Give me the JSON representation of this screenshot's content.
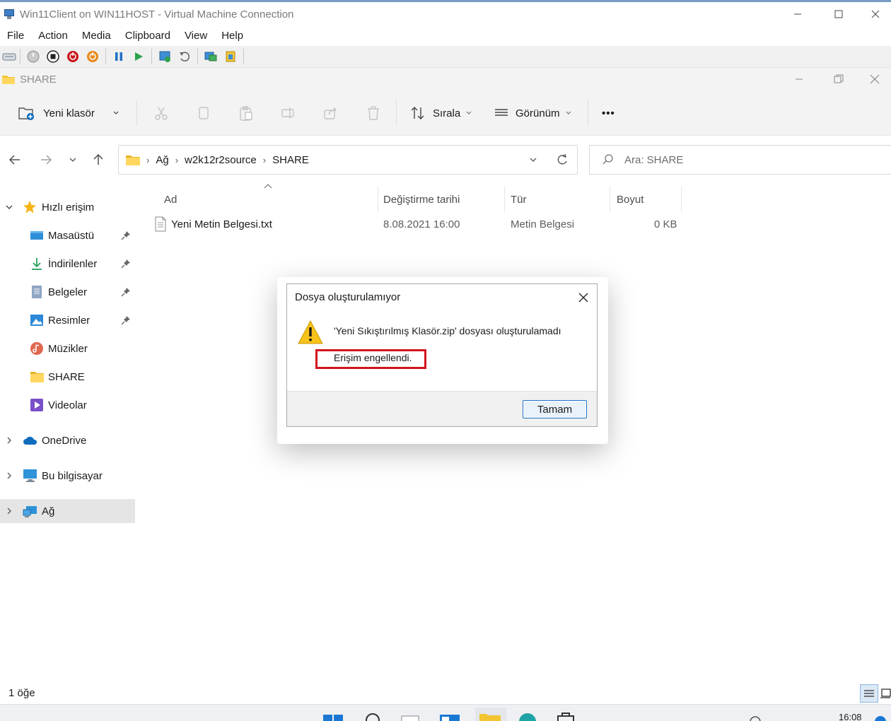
{
  "vm_window": {
    "title": "Win11Client on WIN11HOST - Virtual Machine Connection",
    "menu": [
      "File",
      "Action",
      "Media",
      "Clipboard",
      "View",
      "Help"
    ],
    "toolbar_icons": [
      "ctrl-alt-del-icon",
      "start-icon",
      "turn-off-icon",
      "shutdown-icon",
      "save-icon",
      "pause-icon",
      "resume-icon",
      "checkpoint-icon",
      "revert-icon",
      "enhanced-session-icon",
      "share-icon"
    ]
  },
  "explorer": {
    "title": "SHARE",
    "commands": {
      "new_folder": "Yeni klasör",
      "sort": "Sırala",
      "view": "Görünüm",
      "more": "•••"
    },
    "address": {
      "crumbs": [
        "Ağ",
        "w2k12r2source",
        "SHARE"
      ]
    },
    "search_placeholder": "Ara: SHARE",
    "sidebar": {
      "quick_access": "Hızlı erişim",
      "items": [
        "Masaüstü",
        "İndirilenler",
        "Belgeler",
        "Resimler",
        "Müzikler",
        "SHARE",
        "Videolar"
      ],
      "onedrive": "OneDrive",
      "this_pc": "Bu bilgisayar",
      "network": "Ağ"
    },
    "columns": {
      "name": "Ad",
      "modified": "Değiştirme tarihi",
      "type": "Tür",
      "size": "Boyut"
    },
    "files": [
      {
        "name": "Yeni Metin Belgesi.txt",
        "modified": "8.08.2021 16:00",
        "type": "Metin Belgesi",
        "size": "0 KB"
      }
    ],
    "status": "1 öğe"
  },
  "dialog": {
    "title": "Dosya oluşturulamıyor",
    "message": "'Yeni Sıkıştırılmış Klasör.zip' dosyası oluşturulamadı",
    "detail": "Erişim engellendi.",
    "ok_label": "Tamam"
  },
  "taskbar": {
    "clock": "16:08"
  },
  "colors": {
    "accent": "#0067c0",
    "highlight_box": "#d2141c",
    "warning": "#f7c219"
  }
}
